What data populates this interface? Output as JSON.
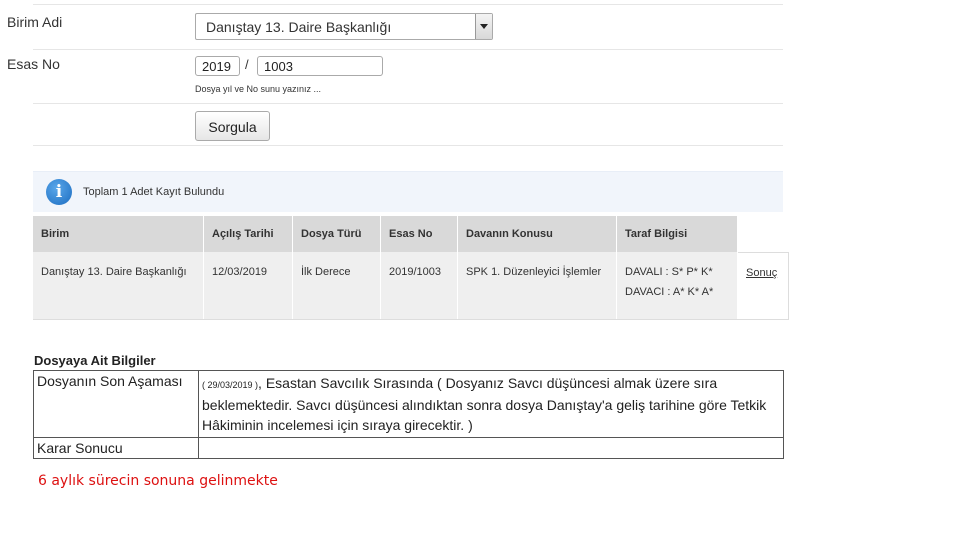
{
  "form": {
    "birim_label": "Birim Adi",
    "birim_value": "Danıştay 13. Daire Başkanlığı",
    "esas_label": "Esas No",
    "year_value": "2019",
    "separator": "/",
    "no_value": "1003",
    "hint": "Dosya yıl ve No sunu yazınız ...",
    "submit_label": "Sorgula"
  },
  "info": {
    "icon": "info-icon",
    "message": "Toplam 1 Adet Kayıt Bulundu",
    "icon_glyph": "i"
  },
  "results": {
    "headers": [
      "Birim",
      "Açılış Tarihi",
      "Dosya Türü",
      "Esas No",
      "Davanın Konusu",
      "Taraf Bilgisi"
    ],
    "rows": [
      {
        "birim": "Danıştay 13. Daire Başkanlığı",
        "acilis": "12/03/2019",
        "tur": "İlk Derece",
        "esas": "2019/1003",
        "konu": "SPK 1. Düzenleyici İşlemler",
        "davali": "DAVALI : S* P* K*",
        "davaci": "DAVACI : A* K* A*",
        "link": "Sonuç"
      }
    ]
  },
  "details": {
    "title": "Dosyaya Ait Bilgiler",
    "son_asama_label": "Dosyanın Son Aşaması",
    "son_asama_date": "( 29/03/2019 )",
    "son_asama_text": ", Esastan Savcılık Sırasında ( Dosyanız Savcı düşüncesi almak üzere sıra beklemektedir. Savcı düşüncesi alındıktan sonra dosya Danıştay'a geliş tarihine göre Tetkik Hâkiminin incelemesi için sıraya girecektir. )",
    "karar_label": "Karar Sonucu",
    "karar_value": ""
  },
  "notice": "6 aylık sürecin sonuna gelinmekte"
}
